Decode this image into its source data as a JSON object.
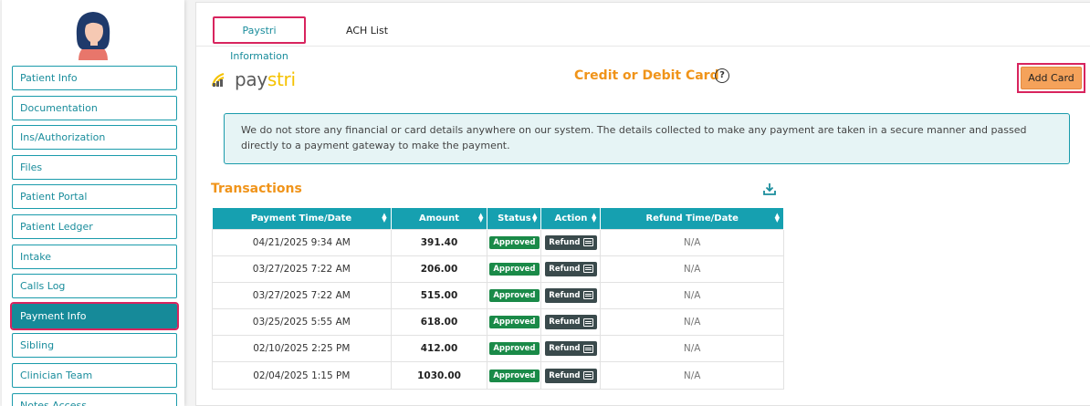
{
  "sidebar": {
    "items": [
      {
        "label": "Patient Info"
      },
      {
        "label": "Documentation"
      },
      {
        "label": "Ins/Authorization"
      },
      {
        "label": "Files"
      },
      {
        "label": "Patient Portal"
      },
      {
        "label": "Patient Ledger"
      },
      {
        "label": "Intake"
      },
      {
        "label": "Calls Log"
      },
      {
        "label": "Payment Info"
      },
      {
        "label": "Sibling"
      },
      {
        "label": "Clinician Team"
      },
      {
        "label": "Notes Access"
      }
    ],
    "active": "Payment Info"
  },
  "tabs": {
    "paystri": "Paystri Information",
    "ach": "ACH List"
  },
  "logo": {
    "pay": "pay",
    "stri": "stri"
  },
  "card_section": {
    "title": "Credit or Debit Card",
    "help_icon": "?",
    "add_card": "Add Card"
  },
  "notice": "We do not store any financial or card details anywhere on our system. The details collected to make any payment are taken in a secure manner and passed directly to a payment gateway to make the payment.",
  "transactions": {
    "title": "Transactions",
    "columns": [
      "Payment Time/Date",
      "Amount",
      "Status",
      "Action",
      "Refund Time/Date"
    ],
    "rows": [
      {
        "time": "04/21/2025 9:34 AM",
        "amount": "391.40",
        "status": "Approved",
        "action": "Refund",
        "refund_time": "N/A"
      },
      {
        "time": "03/27/2025 7:22 AM",
        "amount": "206.00",
        "status": "Approved",
        "action": "Refund",
        "refund_time": "N/A"
      },
      {
        "time": "03/27/2025 7:22 AM",
        "amount": "515.00",
        "status": "Approved",
        "action": "Refund",
        "refund_time": "N/A"
      },
      {
        "time": "03/25/2025 5:55 AM",
        "amount": "618.00",
        "status": "Approved",
        "action": "Refund",
        "refund_time": "N/A"
      },
      {
        "time": "02/10/2025 2:25 PM",
        "amount": "412.00",
        "status": "Approved",
        "action": "Refund",
        "refund_time": "N/A"
      },
      {
        "time": "02/04/2025 1:15 PM",
        "amount": "1030.00",
        "status": "Approved",
        "action": "Refund",
        "refund_time": "N/A"
      }
    ]
  },
  "colors": {
    "teal": "#16a0b0",
    "orange": "#f0941a",
    "highlight": "#d8245e",
    "approved": "#1a8a48"
  }
}
